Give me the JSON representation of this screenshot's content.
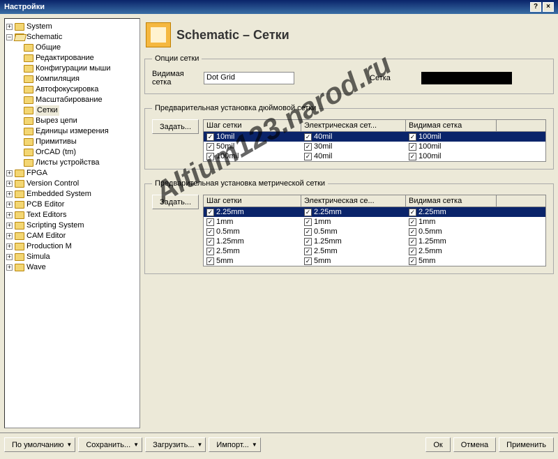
{
  "window": {
    "title": "Настройки"
  },
  "tree": {
    "system": "System",
    "schematic": "Schematic",
    "sch_children": [
      "Общие",
      "Редактирование",
      "Конфигурации мыши",
      "Компиляция",
      "Автофокусировка",
      "Масштабирование",
      "Сетки",
      "Вырез цепи",
      "Единицы измерения",
      "Примитивы",
      "OrCAD (tm)",
      "Листы устройства"
    ],
    "others": [
      "FPGA",
      "Version Control",
      "Embedded System",
      "PCB Editor",
      "Text Editors",
      "Scripting System",
      "CAM Editor",
      "Production M",
      "Simula",
      "Wave"
    ]
  },
  "page": {
    "title": "Schematic – Сетки"
  },
  "opts": {
    "group": "Опции сетки",
    "vis_label": "Видимая сетка",
    "vis_value": "Dot Grid",
    "grid_label": "Сетка"
  },
  "presetImp": {
    "group": "Предварительная установка дюймовой сетки",
    "set_btn": "Задать...",
    "col1": "Шаг сетки",
    "col2": "Электрическая сет...",
    "col3": "Видимая сетка",
    "rows": [
      {
        "c1": "10mil",
        "c2": "40mil",
        "c3": "100mil"
      },
      {
        "c1": "50mil",
        "c2": "30mil",
        "c3": "100mil"
      },
      {
        "c1": "100mil",
        "c2": "40mil",
        "c3": "100mil"
      }
    ]
  },
  "presetMet": {
    "group": "Предварительная установка метрической сетки",
    "set_btn": "Задать...",
    "col1": "Шаг сетки",
    "col2": "Электрическая се...",
    "col3": "Видимая сетка",
    "rows": [
      {
        "c1": "2.25mm",
        "c2": "2.25mm",
        "c3": "2.25mm"
      },
      {
        "c1": "1mm",
        "c2": "1mm",
        "c3": "1mm"
      },
      {
        "c1": "0.5mm",
        "c2": "0.5mm",
        "c3": "0.5mm"
      },
      {
        "c1": "1.25mm",
        "c2": "1.25mm",
        "c3": "1.25mm"
      },
      {
        "c1": "2.5mm",
        "c2": "2.5mm",
        "c3": "2.5mm"
      },
      {
        "c1": "5mm",
        "c2": "5mm",
        "c3": "5mm"
      }
    ]
  },
  "buttons": {
    "defaults": "По умолчанию",
    "save": "Сохранить...",
    "load": "Загрузить...",
    "import": "Импорт...",
    "ok": "Ок",
    "cancel": "Отмена",
    "apply": "Применить"
  },
  "watermark": "Altium123.narod.ru"
}
